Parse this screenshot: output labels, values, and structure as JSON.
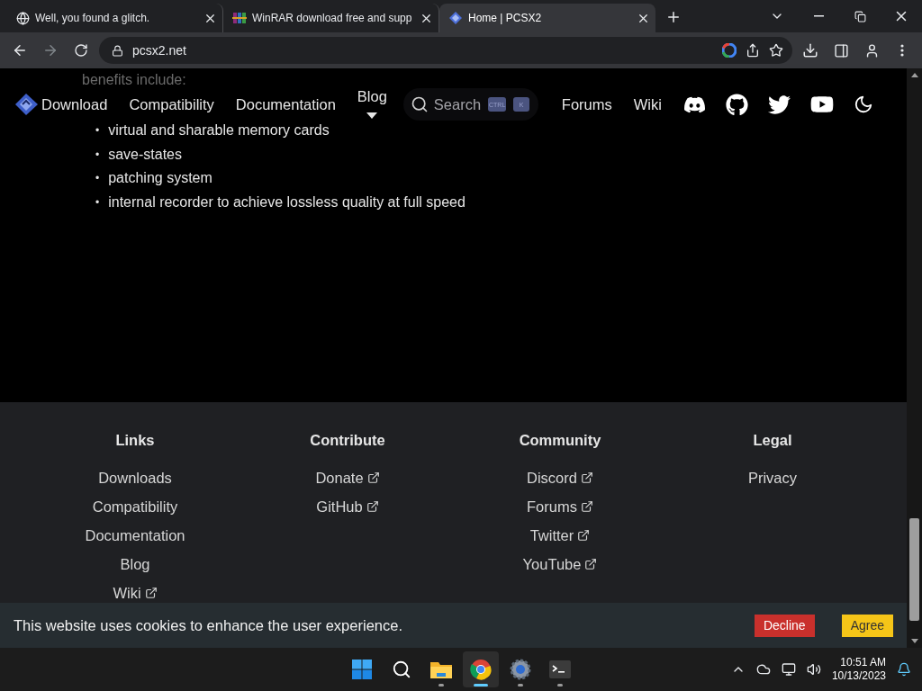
{
  "tabs": [
    {
      "kind": "globe",
      "title": "Well, you found a glitch.",
      "selected": false
    },
    {
      "kind": "archive",
      "title": "WinRAR download free and supp",
      "selected": false
    },
    {
      "kind": "pcsx2",
      "title": "Home | PCSX2",
      "selected": true
    }
  ],
  "address": "pcsx2.net",
  "content": {
    "intro": "benefits include:",
    "bullets": [
      {
        "marker": "•",
        "text": "virtual and sharable memory cards"
      },
      {
        "marker": "•",
        "text": "save-states"
      },
      {
        "marker": "•",
        "text": "patching system"
      },
      {
        "marker": "•",
        "text": "internal recorder to achieve lossless quality at full speed"
      }
    ]
  },
  "nav": {
    "links": [
      "Download",
      "Compatibility",
      "Documentation"
    ],
    "blog": "Blog",
    "search": {
      "placeholder": "Search",
      "keys": [
        "CTRL",
        "K"
      ]
    },
    "right_links": [
      "Forums",
      "Wiki"
    ],
    "socials": [
      {
        "kind": "discord"
      },
      {
        "kind": "github"
      },
      {
        "kind": "twitter"
      },
      {
        "kind": "youtube"
      },
      {
        "kind": "theme"
      }
    ]
  },
  "footer": {
    "columns": [
      {
        "title": "Links",
        "links": [
          {
            "label": "Downloads",
            "external": false
          },
          {
            "label": "Compatibility",
            "external": false
          },
          {
            "label": "Documentation",
            "external": false
          },
          {
            "label": "Blog",
            "external": false
          },
          {
            "label": "Wiki",
            "external": true
          }
        ]
      },
      {
        "title": "Contribute",
        "links": [
          {
            "label": "Donate",
            "external": true
          },
          {
            "label": "GitHub",
            "external": true
          }
        ]
      },
      {
        "title": "Community",
        "links": [
          {
            "label": "Discord",
            "external": true
          },
          {
            "label": "Forums",
            "external": true
          },
          {
            "label": "Twitter",
            "external": true
          },
          {
            "label": "YouTube",
            "external": true
          }
        ]
      },
      {
        "title": "Legal",
        "links": [
          {
            "label": "Privacy",
            "external": false
          }
        ]
      }
    ]
  },
  "cookie": {
    "message": "This website uses cookies to enhance the user experience.",
    "decline": "Decline",
    "agree": "Agree"
  },
  "taskbar": {
    "apps": [
      {
        "kind": "start",
        "selected": false,
        "running": false
      },
      {
        "kind": "search",
        "selected": false,
        "running": false
      },
      {
        "kind": "files",
        "selected": false,
        "running": true
      },
      {
        "kind": "chrome",
        "selected": true,
        "running": true
      },
      {
        "kind": "settings",
        "selected": false,
        "running": true
      },
      {
        "kind": "terminal",
        "selected": false,
        "running": true
      }
    ],
    "time": "10:51 AM",
    "date": "10/13/2023"
  }
}
